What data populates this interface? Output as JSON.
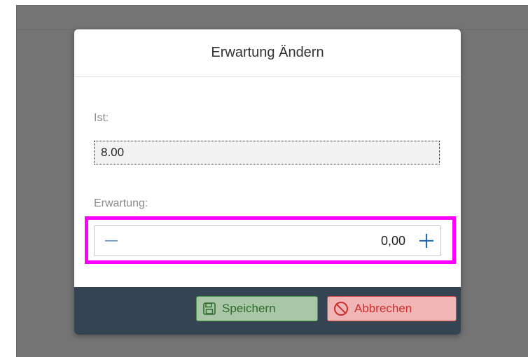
{
  "dialog": {
    "title": "Erwartung Ändern",
    "ist": {
      "label": "Ist:",
      "value": "8.00"
    },
    "erwartung": {
      "label": "Erwartung:",
      "value": "0,00",
      "decrement_icon": "minus-icon",
      "increment_icon": "plus-icon"
    },
    "footer": {
      "save_label": "Speichern",
      "save_icon": "floppy-disk-icon",
      "cancel_label": "Abbrechen",
      "cancel_icon": "prohibited-icon"
    }
  },
  "colors": {
    "overlay": "#747474",
    "footer_bg": "#354453",
    "highlight": "#ff00ff",
    "save_border": "#4d9a4b",
    "cancel_border": "#d54b4b",
    "stepper_icon": "#2a6aa8"
  }
}
